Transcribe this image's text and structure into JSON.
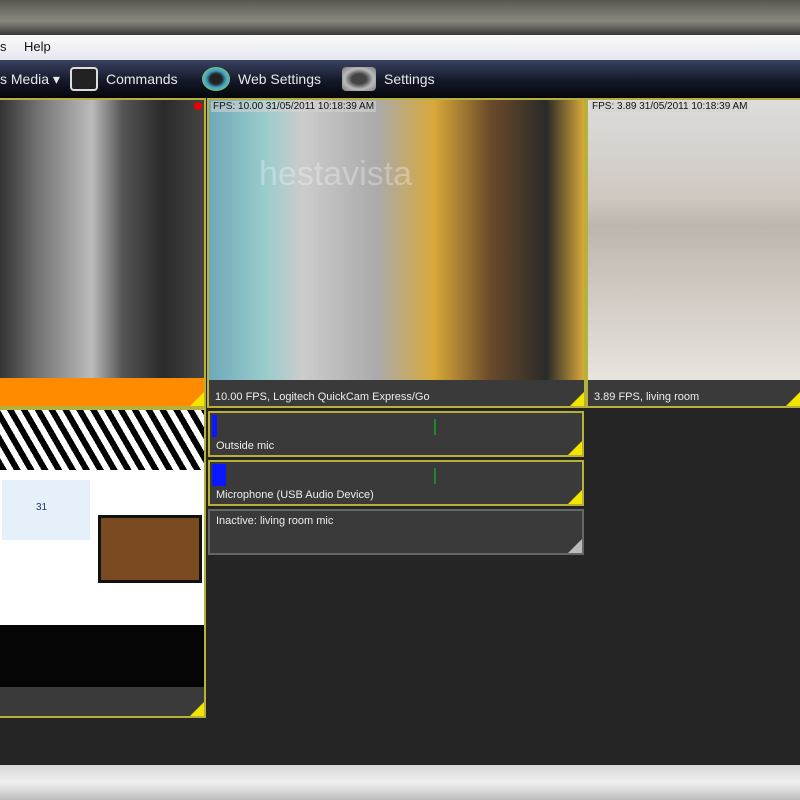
{
  "menu": {
    "items": [
      "s",
      "Help"
    ]
  },
  "toolbar": {
    "media": "s Media ▾",
    "commands": "Commands",
    "web_settings": "Web Settings",
    "settings": "Settings"
  },
  "cameras": [
    {
      "caption": "",
      "status_color": "#ff8c00",
      "recording": true
    },
    {
      "overlay": "FPS: 10.00 31/05/2011 10:18:39 AM",
      "caption": "10.00 FPS, Logitech QuickCam Express/Go",
      "watermark": "hestavista"
    },
    {
      "overlay": "FPS: 3.89 31/05/2011 10:18:39 AM",
      "caption": "3.89 FPS, living room"
    },
    {
      "caption": "",
      "calendar_day": "31"
    }
  ],
  "mics": [
    {
      "label": "Outside mic",
      "level": 0.02
    },
    {
      "label": "Microphone (USB Audio Device)",
      "level": 0.04
    },
    {
      "label": "Inactive: living room mic",
      "level": 0
    }
  ],
  "colors": {
    "accent": "#f2e600",
    "border": "#b7b13a",
    "meter": "#0a17ff"
  }
}
